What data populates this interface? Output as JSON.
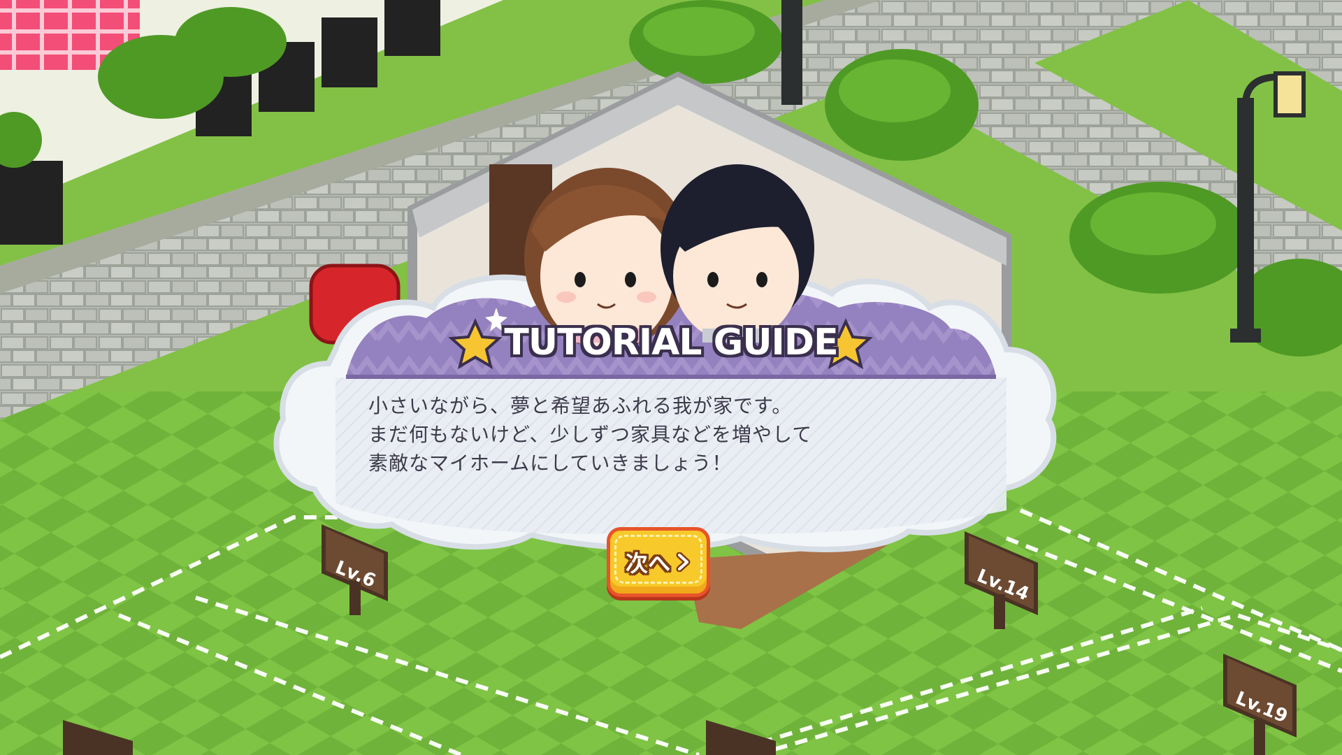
{
  "tutorial": {
    "title": "TUTORIAL GUIDE",
    "lines": [
      "小さいながら、夢と希望あふれる我が家です。",
      "まだ何もないけど、少しずつ家具などを増やして",
      "素敵なマイホームにしていきましょう！"
    ],
    "next_button_label": "次へ",
    "next_button_icon": "chevron-right-icon"
  },
  "plot_signs": [
    {
      "label": "Lv.6"
    },
    {
      "label": "Lv.14"
    },
    {
      "label": "Lv.19"
    }
  ],
  "colors": {
    "grass": "#7cbf3a",
    "path_stone": "#b9bdb5",
    "banner_purple": "#8f7cb8",
    "cloud": "#e8eef4",
    "button_yellow": "#f7c92a",
    "button_border": "#e8532a"
  }
}
